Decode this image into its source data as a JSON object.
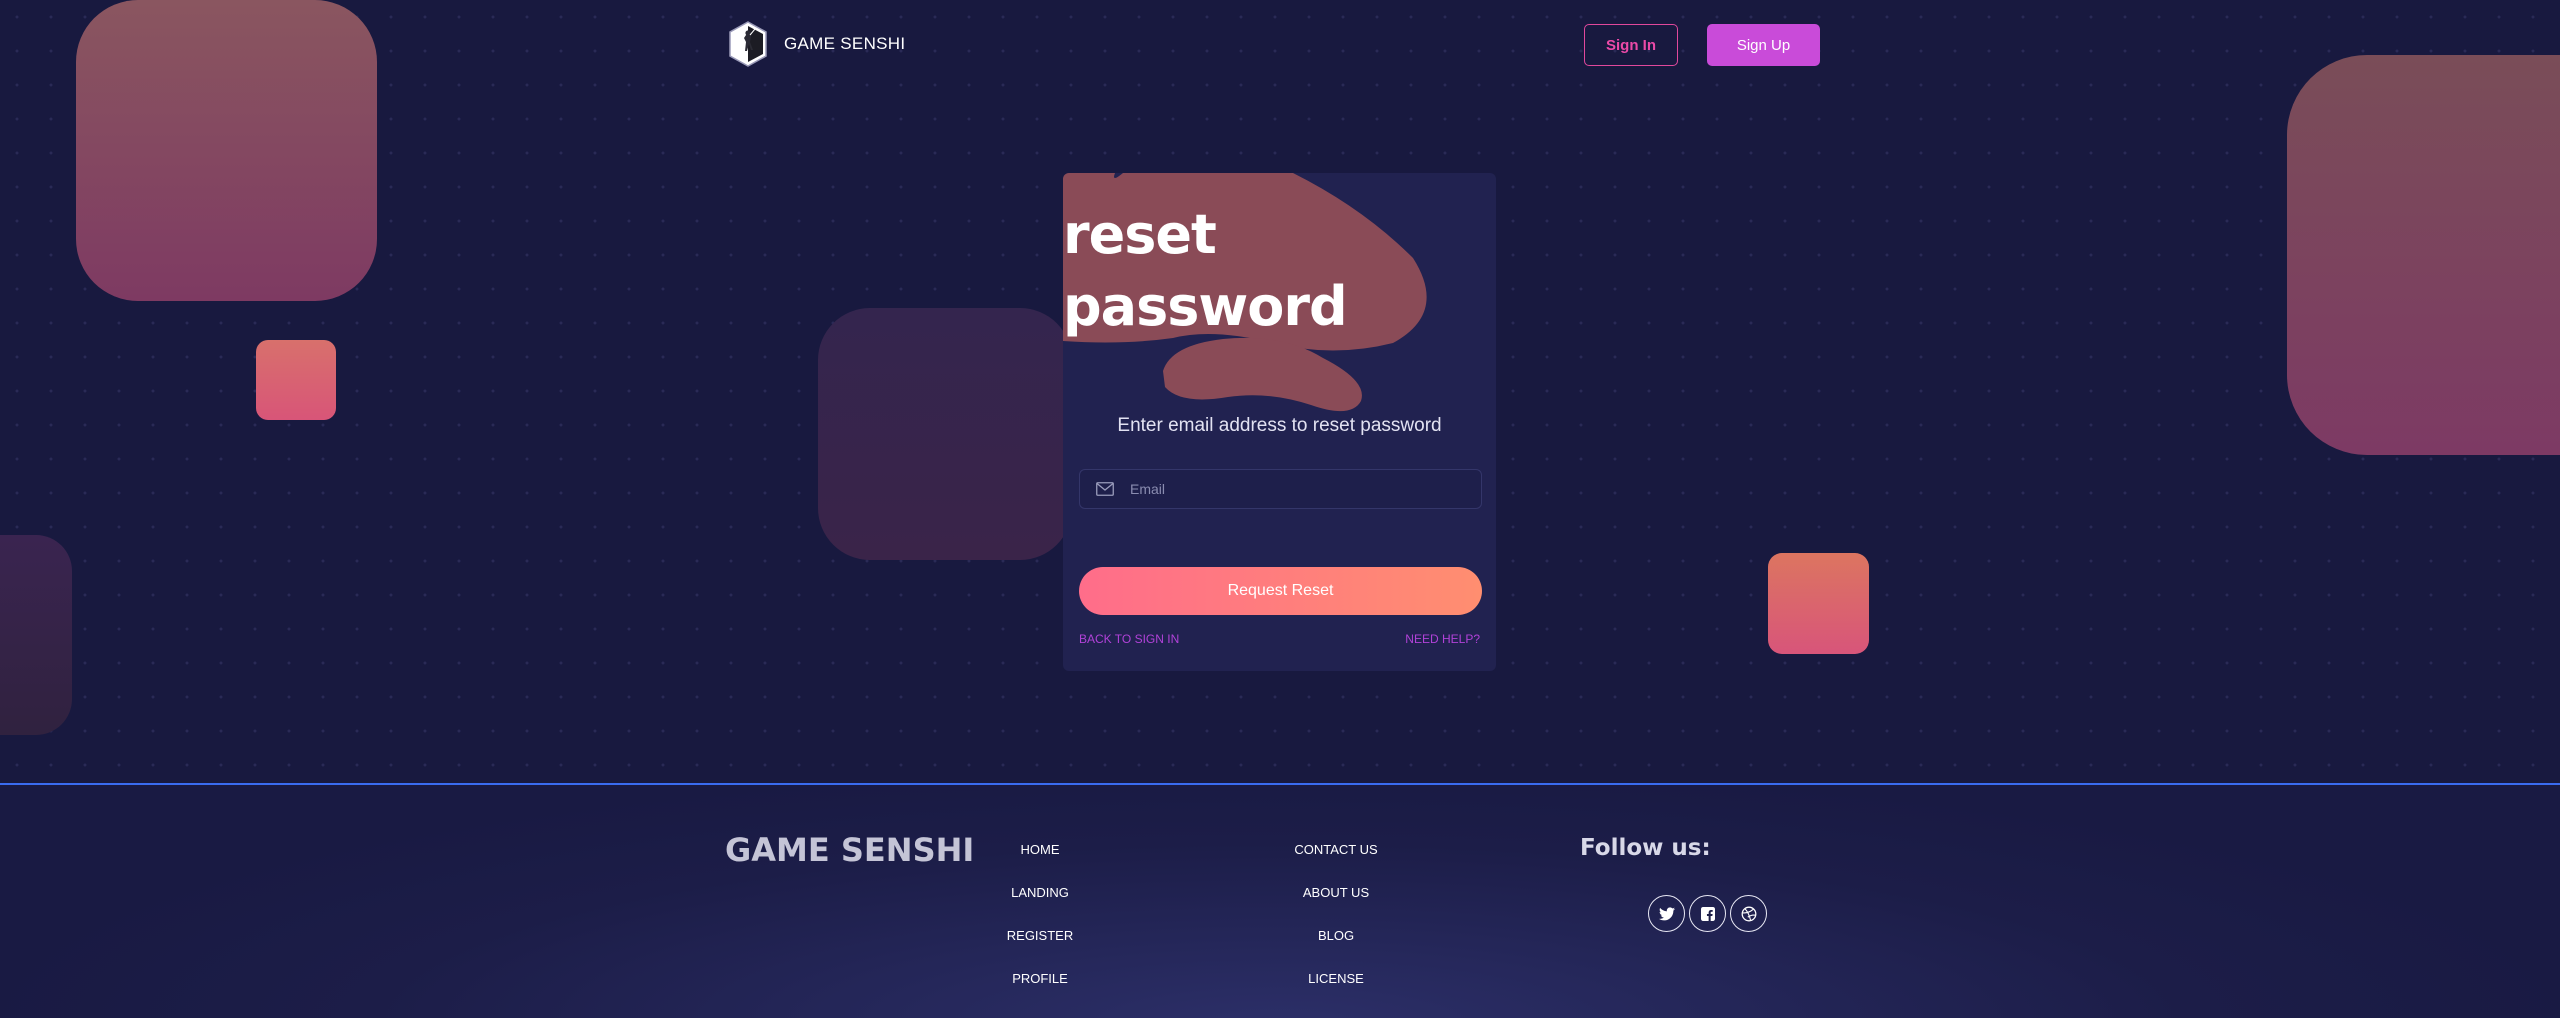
{
  "header": {
    "brand_name": "GAME SENSHI",
    "signin_label": "Sign In",
    "signup_label": "Sign Up"
  },
  "card": {
    "title_line1": "reset",
    "title_line2": "password",
    "subtitle": "Enter email address to reset password",
    "email_placeholder": "Email",
    "email_value": "",
    "submit_label": "Request Reset",
    "back_link": "BACK TO SIGN IN",
    "help_link": "NEED HELP?"
  },
  "footer": {
    "brand": "GAME SENSHI",
    "col1": [
      "HOME",
      "LANDING",
      "REGISTER",
      "PROFILE"
    ],
    "col2": [
      "CONTACT US",
      "ABOUT US",
      "BLOG",
      "LICENSE"
    ],
    "follow_label": "Follow us:",
    "social": [
      "twitter-icon",
      "facebook-icon",
      "dribbble-icon"
    ]
  },
  "colors": {
    "background": "#18193f",
    "card": "#212250",
    "accent_pink": "#e0489c",
    "accent_purple": "#c94bd9",
    "reset_gradient_start": "#ff6d8a",
    "reset_gradient_end": "#ff8e70",
    "link": "#b142d8",
    "footer_border": "#3a6cf0"
  }
}
